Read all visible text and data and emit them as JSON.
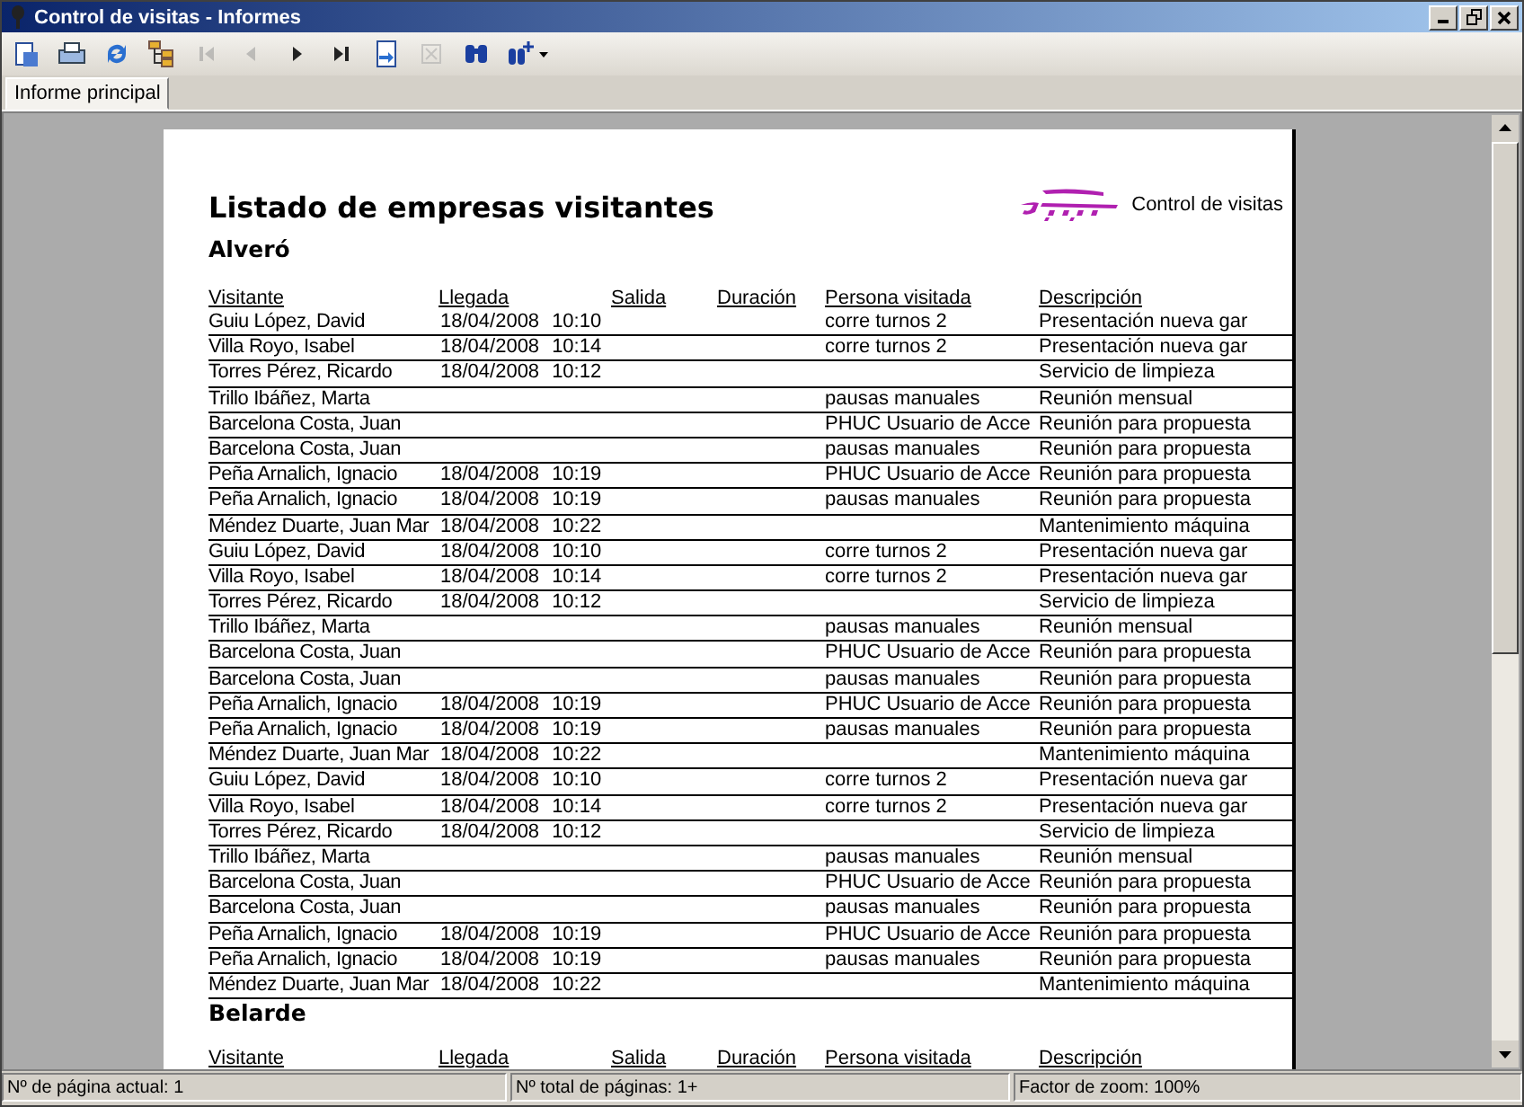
{
  "window": {
    "title": "Control de visitas - Informes"
  },
  "toolbar": [
    {
      "kind": "export",
      "disabled": false
    },
    {
      "kind": "print",
      "disabled": false
    },
    {
      "kind": "refresh",
      "disabled": false
    },
    {
      "kind": "tree",
      "disabled": false
    },
    {
      "kind": "first",
      "disabled": true
    },
    {
      "kind": "prev",
      "disabled": true
    },
    {
      "kind": "next",
      "disabled": false
    },
    {
      "kind": "last",
      "disabled": false
    },
    {
      "kind": "goto",
      "disabled": false
    },
    {
      "kind": "stop",
      "disabled": true
    },
    {
      "kind": "search",
      "disabled": false
    },
    {
      "kind": "zoom",
      "disabled": false
    }
  ],
  "tabs": [
    {
      "label": "Informe principal",
      "selected": true
    }
  ],
  "report": {
    "title": "Listado de empresas visitantes",
    "logo_text": "Control de visitas",
    "groups": [
      {
        "name": "Alveró",
        "columns": [
          "Visitante",
          "Llegada",
          "Salida",
          "Duración",
          "Persona visitada",
          "Descripción"
        ],
        "rows": [
          {
            "visitante": "Guiu López, David",
            "fecha": "18/04/2008",
            "hora": "10:10",
            "persona": "corre turnos 2",
            "descripcion": "Presentación nueva gar"
          },
          {
            "visitante": "Villa Royo, Isabel",
            "fecha": "18/04/2008",
            "hora": "10:14",
            "persona": "corre turnos 2",
            "descripcion": "Presentación nueva gar"
          },
          {
            "visitante": "Torres Pérez, Ricardo",
            "fecha": "18/04/2008",
            "hora": "10:12",
            "descripcion": "Servicio de limpieza"
          },
          {
            "visitante": "Trillo Ibáñez, Marta",
            "persona": "pausas manuales",
            "descripcion": "Reunión mensual"
          },
          {
            "visitante": "Barcelona Costa, Juan",
            "persona": "PHUC Usuario de Acce",
            "descripcion": "Reunión para propuesta"
          },
          {
            "visitante": "Barcelona Costa, Juan",
            "persona": "pausas manuales",
            "descripcion": "Reunión para propuesta"
          },
          {
            "visitante": "Peña Arnalich, Ignacio",
            "fecha": "18/04/2008",
            "hora": "10:19",
            "persona": "PHUC Usuario de Acce",
            "descripcion": "Reunión para propuesta"
          },
          {
            "visitante": "Peña Arnalich, Ignacio",
            "fecha": "18/04/2008",
            "hora": "10:19",
            "persona": "pausas manuales",
            "descripcion": "Reunión para propuesta"
          },
          {
            "visitante": "Méndez Duarte, Juan Mar",
            "fecha": "18/04/2008",
            "hora": "10:22",
            "descripcion": "Mantenimiento máquina"
          },
          {
            "visitante": "Guiu López, David",
            "fecha": "18/04/2008",
            "hora": "10:10",
            "persona": "corre turnos 2",
            "descripcion": "Presentación nueva gar"
          },
          {
            "visitante": "Villa Royo, Isabel",
            "fecha": "18/04/2008",
            "hora": "10:14",
            "persona": "corre turnos 2",
            "descripcion": "Presentación nueva gar"
          },
          {
            "visitante": "Torres Pérez, Ricardo",
            "fecha": "18/04/2008",
            "hora": "10:12",
            "descripcion": "Servicio de limpieza"
          },
          {
            "visitante": "Trillo Ibáñez, Marta",
            "persona": "pausas manuales",
            "descripcion": "Reunión mensual"
          },
          {
            "visitante": "Barcelona Costa, Juan",
            "persona": "PHUC Usuario de Acce",
            "descripcion": "Reunión para propuesta"
          },
          {
            "visitante": "Barcelona Costa, Juan",
            "persona": "pausas manuales",
            "descripcion": "Reunión para propuesta"
          },
          {
            "visitante": "Peña Arnalich, Ignacio",
            "fecha": "18/04/2008",
            "hora": "10:19",
            "persona": "PHUC Usuario de Acce",
            "descripcion": "Reunión para propuesta"
          },
          {
            "visitante": "Peña Arnalich, Ignacio",
            "fecha": "18/04/2008",
            "hora": "10:19",
            "persona": "pausas manuales",
            "descripcion": "Reunión para propuesta"
          },
          {
            "visitante": "Méndez Duarte, Juan Mar",
            "fecha": "18/04/2008",
            "hora": "10:22",
            "descripcion": "Mantenimiento máquina"
          },
          {
            "visitante": "Guiu López, David",
            "fecha": "18/04/2008",
            "hora": "10:10",
            "persona": "corre turnos 2",
            "descripcion": "Presentación nueva gar"
          },
          {
            "visitante": "Villa Royo, Isabel",
            "fecha": "18/04/2008",
            "hora": "10:14",
            "persona": "corre turnos 2",
            "descripcion": "Presentación nueva gar"
          },
          {
            "visitante": "Torres Pérez, Ricardo",
            "fecha": "18/04/2008",
            "hora": "10:12",
            "descripcion": "Servicio de limpieza"
          },
          {
            "visitante": "Trillo Ibáñez, Marta",
            "persona": "pausas manuales",
            "descripcion": "Reunión mensual"
          },
          {
            "visitante": "Barcelona Costa, Juan",
            "persona": "PHUC Usuario de Acce",
            "descripcion": "Reunión para propuesta"
          },
          {
            "visitante": "Barcelona Costa, Juan",
            "persona": "pausas manuales",
            "descripcion": "Reunión para propuesta"
          },
          {
            "visitante": "Peña Arnalich, Ignacio",
            "fecha": "18/04/2008",
            "hora": "10:19",
            "persona": "PHUC Usuario de Acce",
            "descripcion": "Reunión para propuesta"
          },
          {
            "visitante": "Peña Arnalich, Ignacio",
            "fecha": "18/04/2008",
            "hora": "10:19",
            "persona": "pausas manuales",
            "descripcion": "Reunión para propuesta"
          },
          {
            "visitante": "Méndez Duarte, Juan Mar",
            "fecha": "18/04/2008",
            "hora": "10:22",
            "descripcion": "Mantenimiento máquina"
          }
        ]
      },
      {
        "name": "Belarde",
        "columns": [
          "Visitante",
          "Llegada",
          "Salida",
          "Duración",
          "Persona visitada",
          "Descripción"
        ]
      }
    ]
  },
  "status_bar": [
    "Nº de página actual: 1",
    "Nº total de páginas: 1+",
    "Factor de zoom: 100%"
  ]
}
